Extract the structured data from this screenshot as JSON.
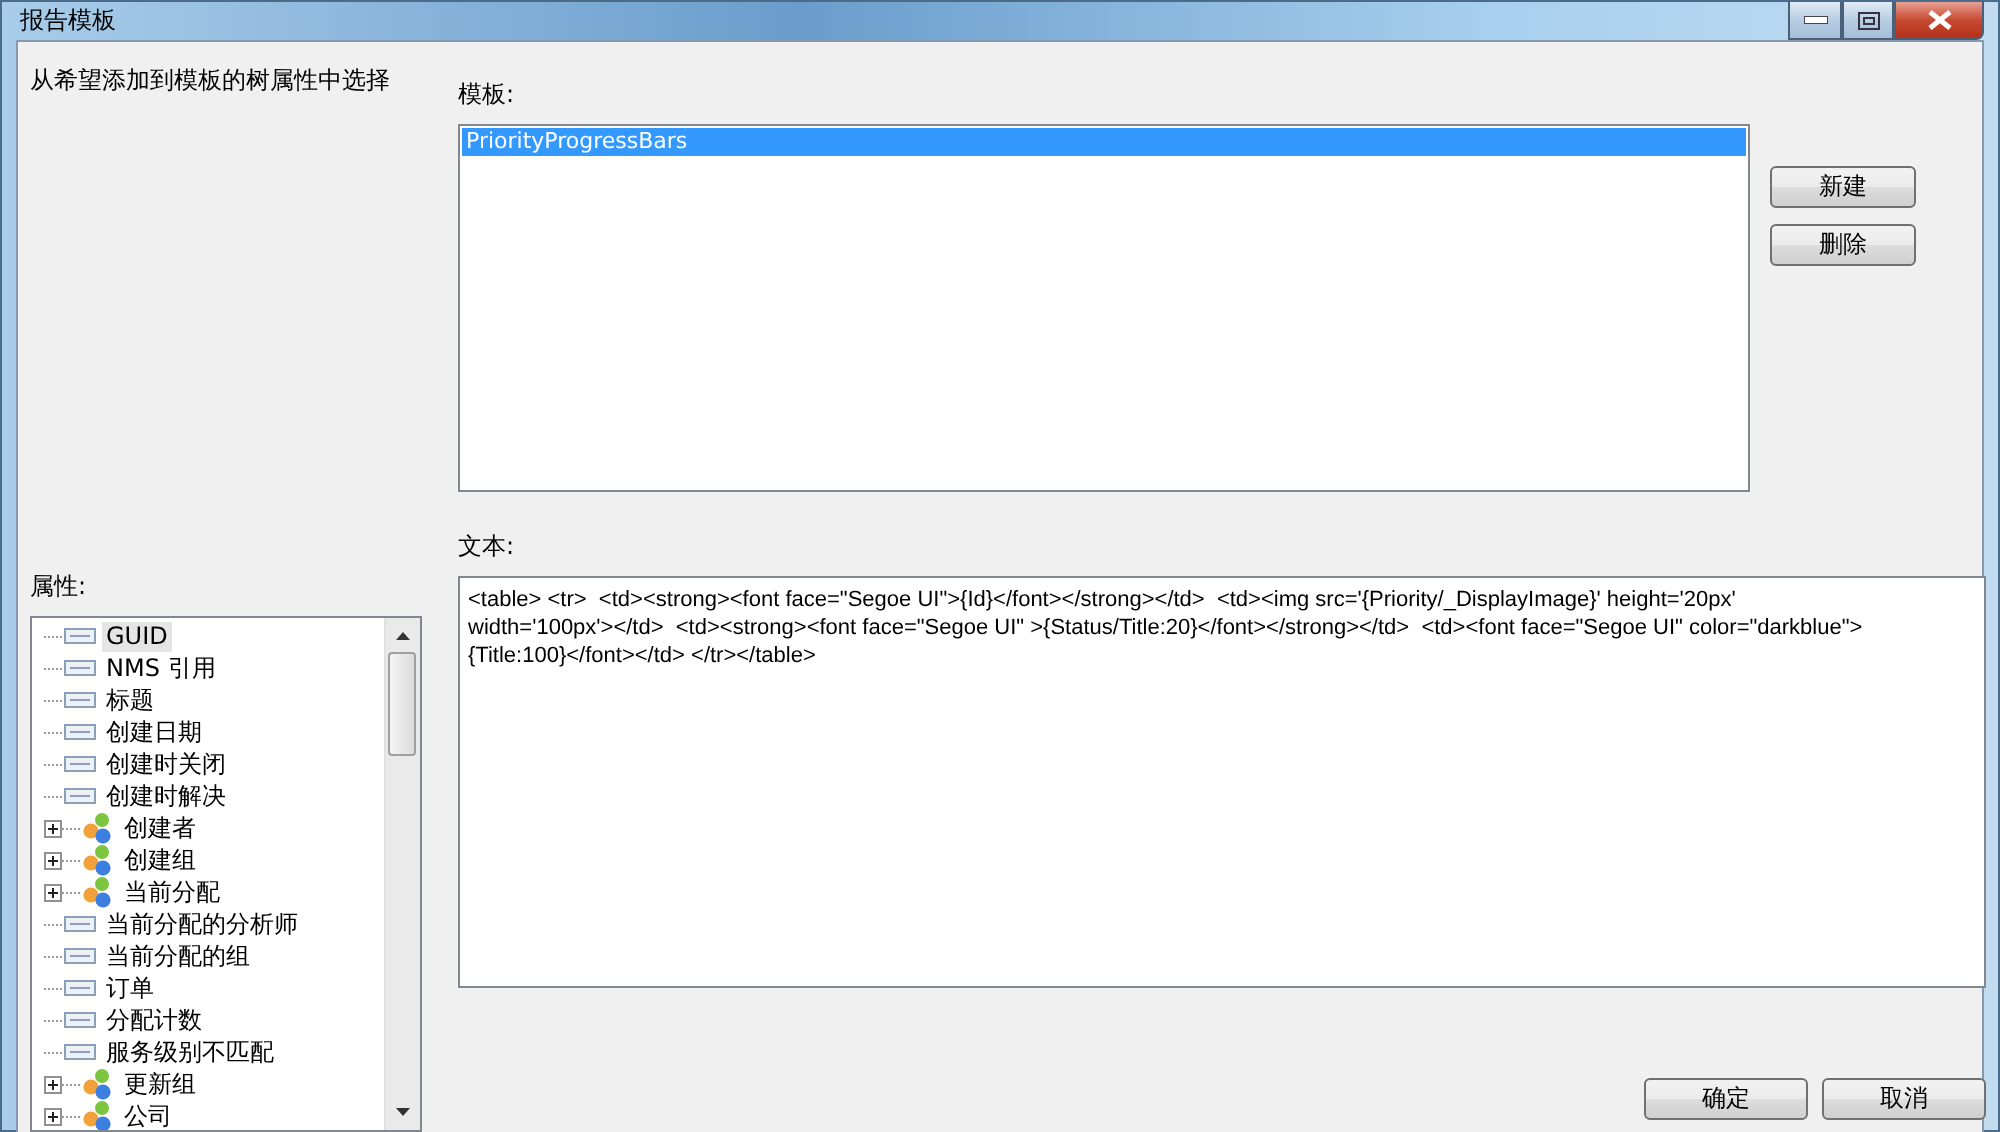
{
  "window": {
    "title": "报告模板"
  },
  "instruction": "从希望添加到模板的树属性中选择",
  "templates": {
    "label": "模板:",
    "items": [
      {
        "text": "PriorityProgressBars",
        "selected": true
      }
    ]
  },
  "side_buttons": [
    "新建",
    "删除"
  ],
  "properties": {
    "label": "属性:",
    "items": [
      {
        "kind": "leaf",
        "text": "GUID",
        "selected": true
      },
      {
        "kind": "leaf",
        "text": "NMS 引用",
        "selected": false
      },
      {
        "kind": "leaf",
        "text": "标题",
        "selected": false
      },
      {
        "kind": "leaf",
        "text": "创建日期",
        "selected": false
      },
      {
        "kind": "leaf",
        "text": "创建时关闭",
        "selected": false
      },
      {
        "kind": "leaf",
        "text": "创建时解决",
        "selected": false
      },
      {
        "kind": "group",
        "text": "创建者",
        "selected": false,
        "expanded": false
      },
      {
        "kind": "group",
        "text": "创建组",
        "selected": false,
        "expanded": false
      },
      {
        "kind": "group",
        "text": "当前分配",
        "selected": false,
        "expanded": false
      },
      {
        "kind": "leaf",
        "text": "当前分配的分析师",
        "selected": false
      },
      {
        "kind": "leaf",
        "text": "当前分配的组",
        "selected": false
      },
      {
        "kind": "leaf",
        "text": "订单",
        "selected": false
      },
      {
        "kind": "leaf",
        "text": "分配计数",
        "selected": false
      },
      {
        "kind": "leaf",
        "text": "服务级别不匹配",
        "selected": false
      },
      {
        "kind": "group",
        "text": "更新组",
        "selected": false,
        "expanded": false
      },
      {
        "kind": "group",
        "text": "公司",
        "selected": false,
        "expanded": false
      }
    ]
  },
  "text_area": {
    "label": "文本:",
    "lines": [
      "<table> <tr>  <td><strong><font face=\"Segoe UI\">{Id}</font></strong></td>  <td><img src='{Priority/_DisplayImage}' height='20px'",
      "width='100px'></td>  <td><strong><font face=\"Segoe UI\" >{Status/Title:20}</font></strong></td>  <td><font face=\"Segoe UI\" color=\"darkblue\">",
      "{Title:100}</font></td> </tr></table>"
    ]
  },
  "buttons": [
    "确定",
    "取消"
  ]
}
